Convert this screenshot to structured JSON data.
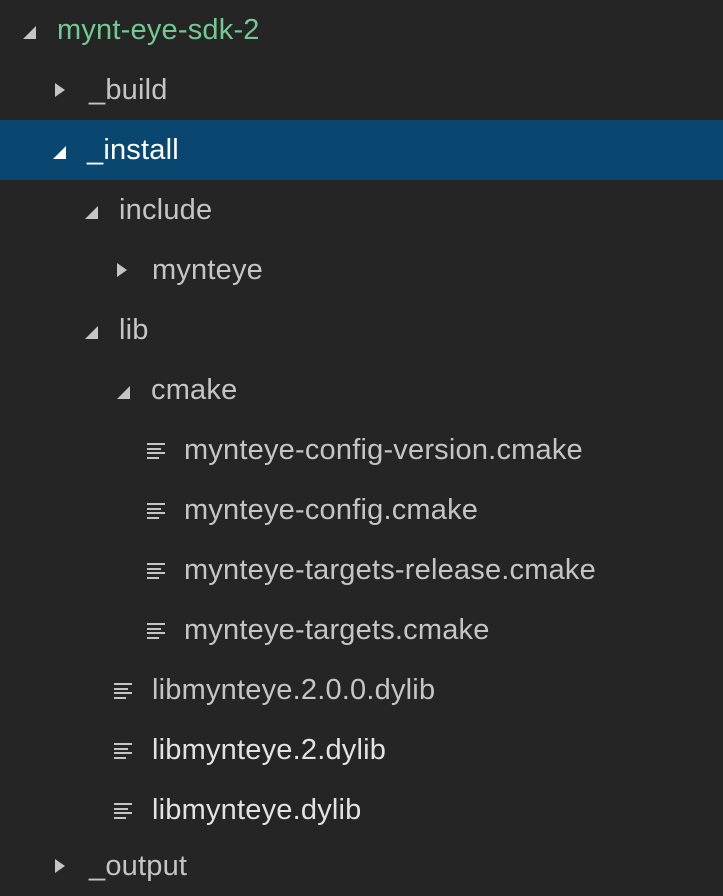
{
  "explorer": {
    "items": [
      {
        "label": "mynt-eye-sdk-2",
        "kind": "folder",
        "expanded": true,
        "icon": "chevron-expanded-icon"
      },
      {
        "label": "_build",
        "kind": "folder",
        "expanded": false,
        "icon": "chevron-collapsed-icon"
      },
      {
        "label": "_install",
        "kind": "folder",
        "expanded": true,
        "selected": true,
        "icon": "chevron-expanded-icon"
      },
      {
        "label": "include",
        "kind": "folder",
        "expanded": true,
        "icon": "chevron-expanded-icon"
      },
      {
        "label": "mynteye",
        "kind": "folder",
        "expanded": false,
        "icon": "chevron-collapsed-icon"
      },
      {
        "label": "lib",
        "kind": "folder",
        "expanded": true,
        "icon": "chevron-expanded-icon"
      },
      {
        "label": "cmake",
        "kind": "folder",
        "expanded": true,
        "icon": "chevron-expanded-icon"
      },
      {
        "label": "mynteye-config-version.cmake",
        "kind": "file",
        "icon": "file-lines-icon"
      },
      {
        "label": "mynteye-config.cmake",
        "kind": "file",
        "icon": "file-lines-icon"
      },
      {
        "label": "mynteye-targets-release.cmake",
        "kind": "file",
        "icon": "file-lines-icon"
      },
      {
        "label": "mynteye-targets.cmake",
        "kind": "file",
        "icon": "file-lines-icon"
      },
      {
        "label": "libmynteye.2.0.0.dylib",
        "kind": "file",
        "icon": "file-lines-icon"
      },
      {
        "label": "libmynteye.2.dylib",
        "kind": "file",
        "icon": "file-lines-icon"
      },
      {
        "label": "libmynteye.dylib",
        "kind": "file",
        "icon": "file-lines-icon"
      },
      {
        "label": "_output",
        "kind": "folder",
        "expanded": false,
        "icon": "chevron-collapsed-icon"
      }
    ]
  },
  "colors": {
    "background": "#252526",
    "selection": "#094771",
    "root_label": "#73c991",
    "text": "#c5c5c5"
  }
}
